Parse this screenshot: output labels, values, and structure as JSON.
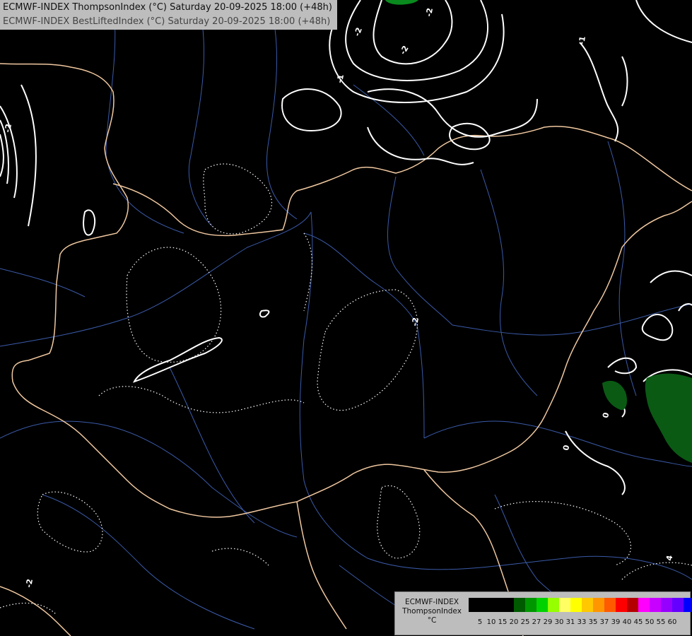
{
  "title": {
    "line1": "ECMWF-INDEX ThompsonIndex (°C) Saturday 20-09-2025 18:00 (+48h)",
    "line2": "ECMWF-INDEX BestLiftedIndex (°C) Saturday 20-09-2025 18:00 (+48h)"
  },
  "legend": {
    "line1": "ECMWF-INDEX",
    "line2": "ThompsonIndex",
    "line3": "°C",
    "colors": [
      "#000000",
      "#000000",
      "#000000",
      "#000000",
      "#005a00",
      "#009600",
      "#00d200",
      "#96ff00",
      "#ffff64",
      "#ffff00",
      "#ffc800",
      "#ff9600",
      "#ff5a00",
      "#ff0000",
      "#b40000",
      "#ff00ff",
      "#c800ff",
      "#9600ff",
      "#6400ff",
      "#0000ff"
    ],
    "ticks": [
      "5",
      "10",
      "15",
      "20",
      "25",
      "27",
      "29",
      "30",
      "31",
      "33",
      "35",
      "37",
      "39",
      "40",
      "45",
      "50",
      "55",
      "60"
    ]
  },
  "contour_labels": [
    "-2",
    "-2",
    "-2",
    "-1",
    "-1",
    "-2",
    "-2",
    "0",
    "0",
    "-2",
    "4"
  ]
}
